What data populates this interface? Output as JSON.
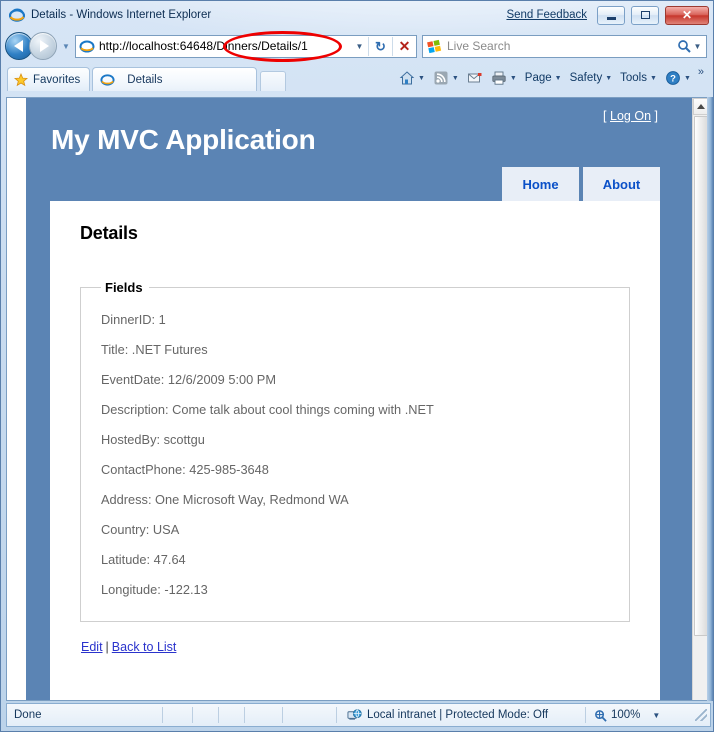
{
  "window": {
    "title": "Details - Windows Internet Explorer",
    "send_feedback": "Send Feedback",
    "minimize_label": "Minimize",
    "maximize_label": "Maximize",
    "close_label": "Close"
  },
  "navigation": {
    "back_label": "Back",
    "forward_label": "Forward",
    "recent_pages_label": "Recent Pages",
    "address_value": "http://localhost:64648/Dinners/Details/1",
    "address_dropdown_label": "Address dropdown",
    "refresh_glyph": "↻",
    "stop_glyph": "✕",
    "search_placeholder": "Live Search",
    "search_dropdown_label": "Search provider"
  },
  "tabbar": {
    "favorites_label": "Favorites",
    "tabs": [
      {
        "label": "Details"
      }
    ],
    "new_tab_label": "New Tab"
  },
  "commandbar": {
    "home_label": "Home",
    "feeds_label": "Feeds",
    "mail_label": "Read Mail",
    "print_label": "Print",
    "items": [
      {
        "label": "Page"
      },
      {
        "label": "Safety"
      },
      {
        "label": "Tools"
      }
    ],
    "help_label": "Help",
    "overflow_glyph": "»",
    "caret_glyph": "▼"
  },
  "site": {
    "title": "My MVC Application",
    "logon_open": "[",
    "logon_link": "Log On",
    "logon_close": "]",
    "nav": [
      {
        "label": "Home"
      },
      {
        "label": "About"
      }
    ]
  },
  "content": {
    "page_title": "Details",
    "fieldset_legend": "Fields",
    "fields": [
      {
        "text": "DinnerID: 1"
      },
      {
        "text": "Title: .NET Futures"
      },
      {
        "text": "EventDate: 12/6/2009 5:00 PM"
      },
      {
        "text": "Description: Come talk about cool things coming with .NET"
      },
      {
        "text": "HostedBy: scottgu"
      },
      {
        "text": "ContactPhone: 425-985-3648"
      },
      {
        "text": "Address: One Microsoft Way, Redmond WA"
      },
      {
        "text": "Country: USA"
      },
      {
        "text": "Latitude: 47.64"
      },
      {
        "text": "Longitude: -122.13"
      }
    ],
    "actions": {
      "edit_label": "Edit",
      "separator": "|",
      "back_to_list_label": "Back to List"
    }
  },
  "statusbar": {
    "status": "Done",
    "zone": "Local intranet | Protected Mode: Off",
    "zoom": "100%",
    "zoom_caret": "▼"
  },
  "annotation": {
    "shape": "red-ellipse",
    "target_text": "/Dinners/Details/1",
    "color": "#ee0000"
  },
  "colors": {
    "site_header_blue": "#5b84b4",
    "nav_tab_bg": "#e8eef7",
    "nav_tab_text": "#0a50c8",
    "link_blue": "#2a33cc",
    "field_text": "#666666"
  }
}
